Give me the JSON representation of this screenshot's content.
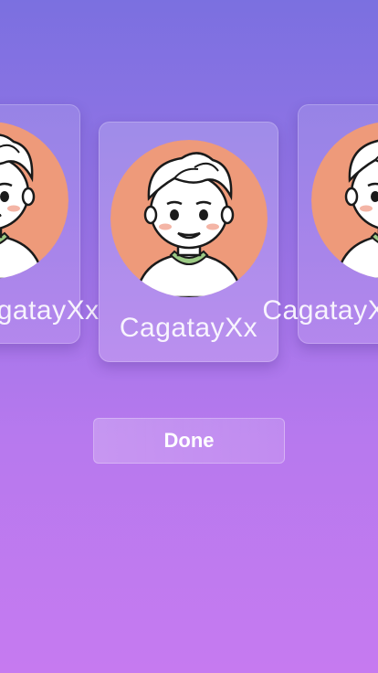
{
  "profiles": [
    {
      "name": "CagatayXx",
      "avatar_icon": "cartoon-boy-avatar",
      "avatar_bg": "#ee9a7a"
    },
    {
      "name": "CagatayXx",
      "avatar_icon": "cartoon-boy-avatar",
      "avatar_bg": "#ee9a7a"
    },
    {
      "name": "CagatayXx",
      "avatar_icon": "cartoon-boy-avatar",
      "avatar_bg": "#ee9a7a"
    }
  ],
  "done_label": "Done",
  "colors": {
    "background_top": "#7b70e0",
    "background_bottom": "#c67af0",
    "shirt_collar": "#9dcb86"
  }
}
